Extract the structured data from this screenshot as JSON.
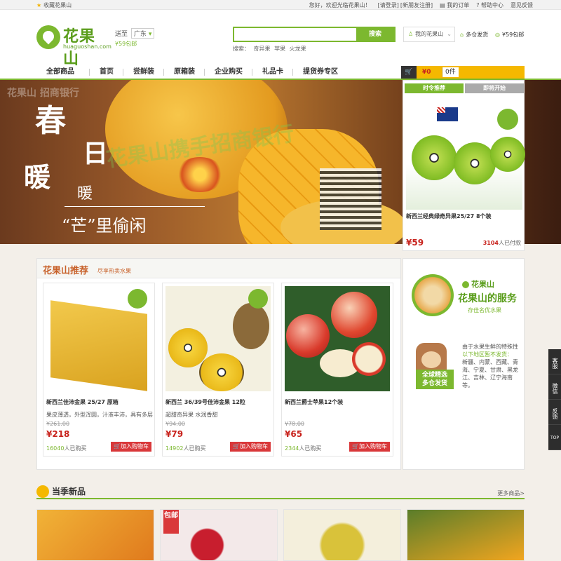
{
  "topbar": {
    "favorite": "收藏花果山",
    "greeting": "您好，欢迎光临花果山！",
    "login": "[请登录]",
    "register": "[新朋友注册]",
    "orders": "我的订单",
    "help": "帮助中心",
    "feedback": "意见反馈"
  },
  "logo": {
    "cn": "花果山",
    "en": "huaguoshan.com"
  },
  "delivery": {
    "label": "送至",
    "region": "广东",
    "shipping": "¥59包邮"
  },
  "search": {
    "placeholder": "",
    "button": "搜索",
    "hot_label": "搜索：",
    "hot": [
      "奇异果",
      "苹果",
      "火龙果"
    ]
  },
  "account": {
    "my": "我的花果山",
    "warehouse": "多仓发货",
    "free_ship": "¥59包邮"
  },
  "nav": {
    "items": [
      "全部商品",
      "首页",
      "尝鲜装",
      "原箱装",
      "企业购买",
      "礼品卡",
      "提货券专区"
    ]
  },
  "cart": {
    "amount": "¥0",
    "count": "0件"
  },
  "banner": {
    "line1": "春",
    "line2": "日",
    "line3": "暖",
    "line4": "暖",
    "line5": "“芒”里偷闲",
    "watermark1": "花果山 招商银行",
    "watermark2": "花果山携手招商银行"
  },
  "timely": {
    "tabs": [
      "时令推荐",
      "即将开始"
    ],
    "name": "新西兰经典绿奇异果25/27 8个装",
    "price": "¥59",
    "paid_count": "3104",
    "paid_suffix": "人已付款"
  },
  "recommend": {
    "title": "花果山推荐",
    "subtitle": "尽享热卖水果",
    "products": [
      {
        "name": "新西兰佳沛金果 25/27 原箱",
        "desc": "果皮薄透，外型浑圆，汁液丰沛，具有多层次...",
        "old_price": "¥261.00",
        "price": "¥218",
        "sold": "16040",
        "sold_suffix": "人已购买",
        "add": "加入购物车"
      },
      {
        "name": "新西兰 36/39号佳沛金果 12粒",
        "desc": "超甜奇异果 水润香甜",
        "old_price": "¥94.00",
        "price": "¥79",
        "sold": "14902",
        "sold_suffix": "人已购买",
        "add": "加入购物车"
      },
      {
        "name": "新西兰爵士苹果12个装",
        "desc": "",
        "old_price": "¥78.00",
        "price": "¥65",
        "sold": "2344",
        "sold_suffix": "人已购买",
        "add": "加入购物车"
      }
    ]
  },
  "service": {
    "brand": "花果山",
    "title": "花果山的服务",
    "slogan": "存佳名优水果",
    "global": "全球精选",
    "warehouse": "多仓发货",
    "note_intro": "由于水果生鲜的特殊性",
    "note_green": "以下地区暂不发货：",
    "note_regions": "新疆、内蒙、西藏、青海、宁夏、甘肃、黑龙江、吉林、辽宁海南等。"
  },
  "season": {
    "title": "当季新品",
    "more": "更多商品>"
  },
  "thumbs": {
    "tag": "包邮"
  },
  "sidebar": {
    "service": "客服",
    "wechat": "微信",
    "feedback": "反馈",
    "top": "TOP"
  },
  "colors": {
    "brand_green": "#7cb82f",
    "price_red": "#c8231d",
    "cart_yellow": "#f5b800"
  }
}
